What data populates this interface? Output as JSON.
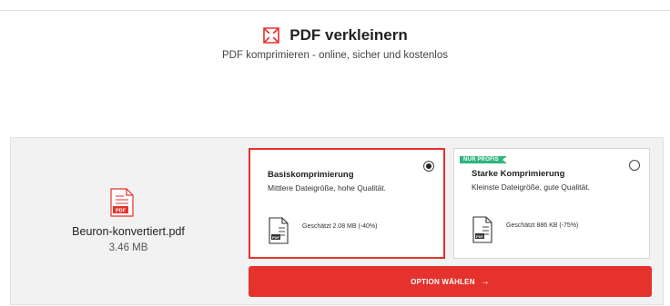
{
  "header": {
    "title": "PDF verkleinern",
    "subtitle": "PDF komprimieren - online, sicher und kostenlos",
    "icon": "compress-icon",
    "accent_color": "#e5322d"
  },
  "file": {
    "name": "Beuron-konvertiert.pdf",
    "size": "3.46 MB",
    "icon": "pdf-file-icon",
    "icon_label": "PDF"
  },
  "options": [
    {
      "title": "Basiskomprimierung",
      "description": "Mittlere Dateigröße, hohe Qualität.",
      "estimate": "Geschätzt 2.08 MB (-40%)",
      "selected": true,
      "badge": ""
    },
    {
      "title": "Starke Komprimierung",
      "description": "Kleinste Dateigröße, gute Qualität.",
      "estimate": "Geschätzt 886 KB (-75%)",
      "selected": false,
      "badge": "NUR PROFIS",
      "badge_color": "#2fb57e"
    }
  ],
  "action": {
    "label": "OPTION WÄHLEN",
    "arrow": "→"
  }
}
